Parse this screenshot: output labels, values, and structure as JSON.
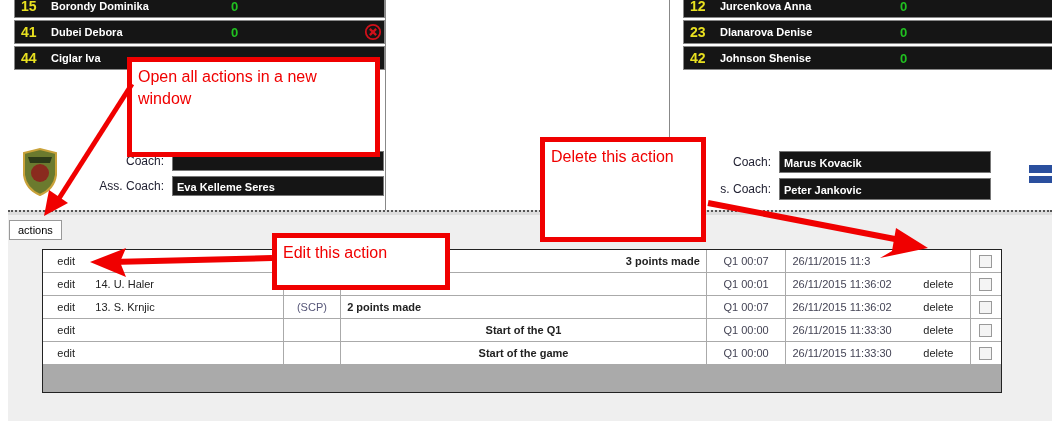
{
  "home": {
    "players": [
      {
        "number": "15",
        "name": "Borondy Dominika",
        "points": "0",
        "remove_icon": false
      },
      {
        "number": "41",
        "name": "Dubei Debora",
        "points": "0",
        "remove_icon": true
      },
      {
        "number": "44",
        "name": "Ciglar Iva",
        "remove_icon": false
      }
    ],
    "coach_label": "Coach:",
    "assistant_label": "Ass. Coach:",
    "assistant": "Eva Kelleme Seres"
  },
  "away": {
    "players": [
      {
        "number": "12",
        "name": "Jurcenkova Anna",
        "points": "0",
        "remove_icon": false
      },
      {
        "number": "23",
        "name": "Dlanarova Denise",
        "points": "0",
        "remove_icon": false
      },
      {
        "number": "42",
        "name": "Johnson Shenise",
        "points": "0",
        "remove_icon": false
      }
    ],
    "coach_label": "Coach:",
    "coach": "Marus Kovacik",
    "assistant_label": "s. Coach:",
    "assistant": "Peter Jankovic"
  },
  "actions_button": "actions",
  "actions": [
    {
      "kind": "away",
      "edit": "edit",
      "action": "3 points made",
      "time": "Q1 00:07",
      "date": "26/11/2015 11:3",
      "checked": false
    },
    {
      "kind": "home",
      "edit": "edit",
      "player": "14. U. Haler",
      "time": "Q1 00:01",
      "date": "26/11/2015 11:36:02",
      "delete": "delete",
      "checked": false
    },
    {
      "kind": "home",
      "edit": "edit",
      "player": "13. S. Krnjic",
      "tag": "(SCP)",
      "action": "2 points made",
      "time": "Q1 00:07",
      "date": "26/11/2015 11:36:02",
      "delete": "delete",
      "checked": false
    },
    {
      "kind": "game",
      "edit": "edit",
      "action": "Start of the Q1",
      "time": "Q1 00:00",
      "date": "26/11/2015 11:33:30",
      "delete": "delete",
      "checked": false
    },
    {
      "kind": "game",
      "edit": "edit",
      "action": "Start of the game",
      "time": "Q1 00:00",
      "date": "26/11/2015 11:33:30",
      "delete": "delete",
      "checked": false
    }
  ],
  "callouts": [
    {
      "text": "Open all actions in a new window"
    },
    {
      "text": "Edit this action"
    },
    {
      "text": "Delete this action"
    }
  ]
}
